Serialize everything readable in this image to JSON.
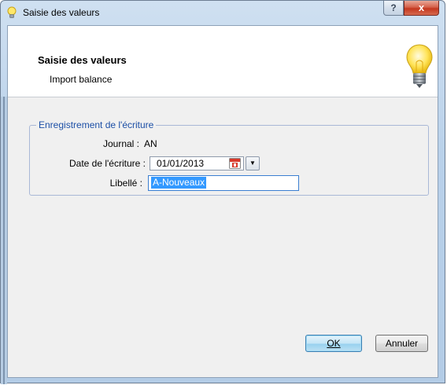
{
  "window": {
    "title": "Saisie des valeurs",
    "help_label": "?",
    "close_label": "x"
  },
  "header": {
    "title": "Saisie des valeurs",
    "subtitle": "Import balance"
  },
  "group": {
    "legend": "Enregistrement de l'écriture",
    "journal_label": "Journal :",
    "journal_value": "AN",
    "date_label": "Date de l'écriture :",
    "date_value": "01/01/2013",
    "libelle_label": "Libellé :",
    "libelle_value": "A-Nouveaux"
  },
  "buttons": {
    "ok_label": "OK",
    "cancel_label": "Annuler"
  },
  "colors": {
    "legend_text": "#1c4fa6",
    "selection": "#3399ff",
    "close_button": "#c4371f"
  },
  "icons": {
    "title": "lightbulb-icon",
    "header": "lightbulb-icon",
    "calendar": "calendar-icon",
    "dropdown": "chevron-down-icon"
  }
}
